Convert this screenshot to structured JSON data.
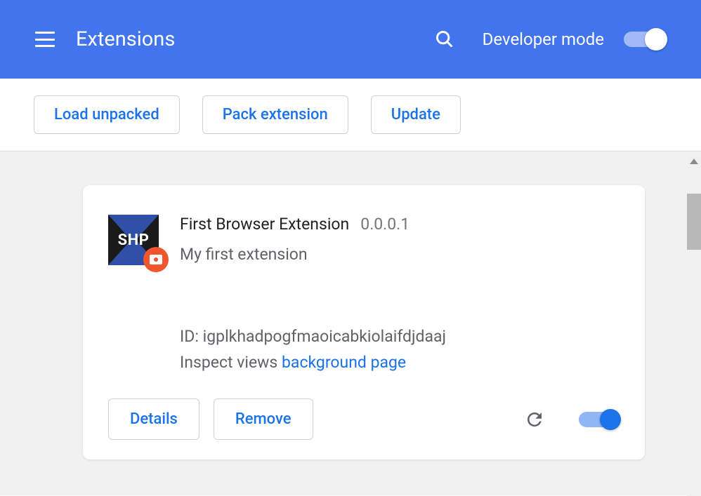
{
  "header": {
    "title": "Extensions",
    "dev_mode_label": "Developer mode"
  },
  "toolbar": {
    "load_unpacked": "Load unpacked",
    "pack_extension": "Pack extension",
    "update": "Update"
  },
  "extension": {
    "icon_text": "SHP",
    "name": "First Browser Extension",
    "version": "0.0.0.1",
    "description": "My first extension",
    "id_label": "ID:",
    "id_value": "igplkhadpogfmaoicabkiolaifdjdaaj",
    "inspect_label": "Inspect views",
    "inspect_link": "background page",
    "details_label": "Details",
    "remove_label": "Remove"
  }
}
